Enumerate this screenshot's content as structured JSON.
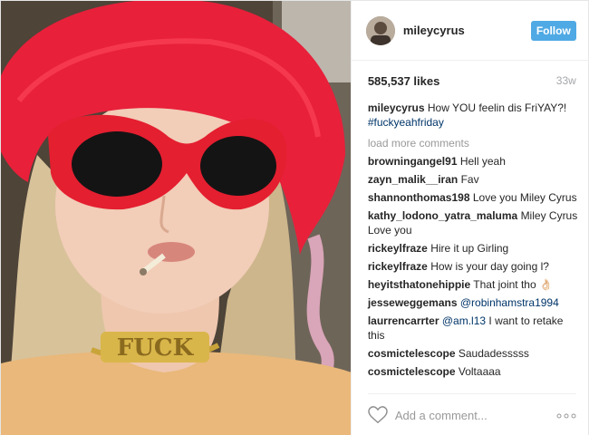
{
  "header": {
    "username": "mileycyrus",
    "follow_label": "Follow"
  },
  "stats": {
    "likes": "585,537 likes",
    "age": "33w"
  },
  "caption": {
    "user": "mileycyrus",
    "text": "How YOU feelin dis FriYAY?!",
    "hashtag": "#fuckyeahfriday"
  },
  "load_more": "load more comments",
  "comments": [
    {
      "user": "browningangel91",
      "text": "Hell yeah"
    },
    {
      "user": "zayn_malik__iran",
      "text": "Fav"
    },
    {
      "user": "shannonthomas198",
      "text": "Love you Miley Cyrus"
    },
    {
      "user": "kathy_lodono_yatra_maluma",
      "text": "Miley Cyrus Love you"
    },
    {
      "user": "rickeylfraze",
      "text": "Hire it up Girling"
    },
    {
      "user": "rickeylfraze",
      "text": "How is your day going l?"
    },
    {
      "user": "heyitsthatonehippie",
      "text": "That joint tho 👌🏻"
    },
    {
      "user": "jesseweggemans",
      "text": "",
      "mention": "@robinhamstra1994"
    },
    {
      "user": "laurrencarrter",
      "mention": "@am.l13",
      "text": "I want to retake this"
    },
    {
      "user": "cosmictelescope",
      "text": "Saudadesssss"
    },
    {
      "user": "cosmictelescope",
      "text": "Voltaaaa"
    }
  ],
  "add_comment": {
    "placeholder": "Add a comment..."
  },
  "photo": {
    "necklace_text": "FUCK"
  },
  "colors": {
    "follow": "#4fa9e4",
    "hat": "#e8203a",
    "link": "#003569"
  },
  "icons": {
    "like": "heart-icon",
    "options": "more-options-icon"
  }
}
